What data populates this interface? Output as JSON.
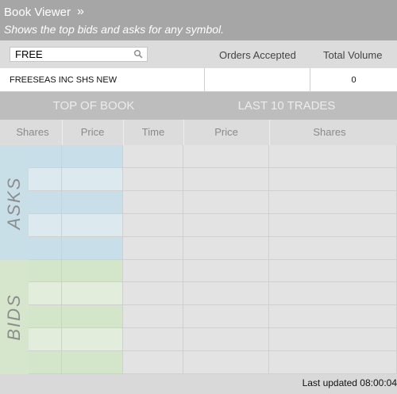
{
  "header": {
    "title": "Book Viewer",
    "chevron": "»",
    "subtitle": "Shows the top bids and asks for any symbol."
  },
  "search": {
    "value": "FREE",
    "icon": "search-icon"
  },
  "columns": {
    "orders_accepted": "Orders Accepted",
    "total_volume": "Total Volume"
  },
  "security": {
    "name": "FREESEAS INC SHS NEW",
    "orders_accepted": "",
    "total_volume": "0"
  },
  "tabs": {
    "top_of_book": "TOP OF BOOK",
    "last_trades": "LAST 10 TRADES"
  },
  "book_headers": {
    "shares": "Shares",
    "price": "Price"
  },
  "trade_headers": {
    "time": "Time",
    "price": "Price",
    "shares": "Shares"
  },
  "sides": {
    "asks": "ASKS",
    "bids": "BIDS"
  },
  "colors": {
    "asks_dark": "#c8dfe9",
    "asks_light": "#dce9ee",
    "bids_dark": "#d3e6c9",
    "bids_light": "#e2eddb",
    "trade_dark": "#e3e3e3",
    "trade_light": "#ededed"
  },
  "footer": {
    "last_updated": "Last updated 08:00:04"
  }
}
